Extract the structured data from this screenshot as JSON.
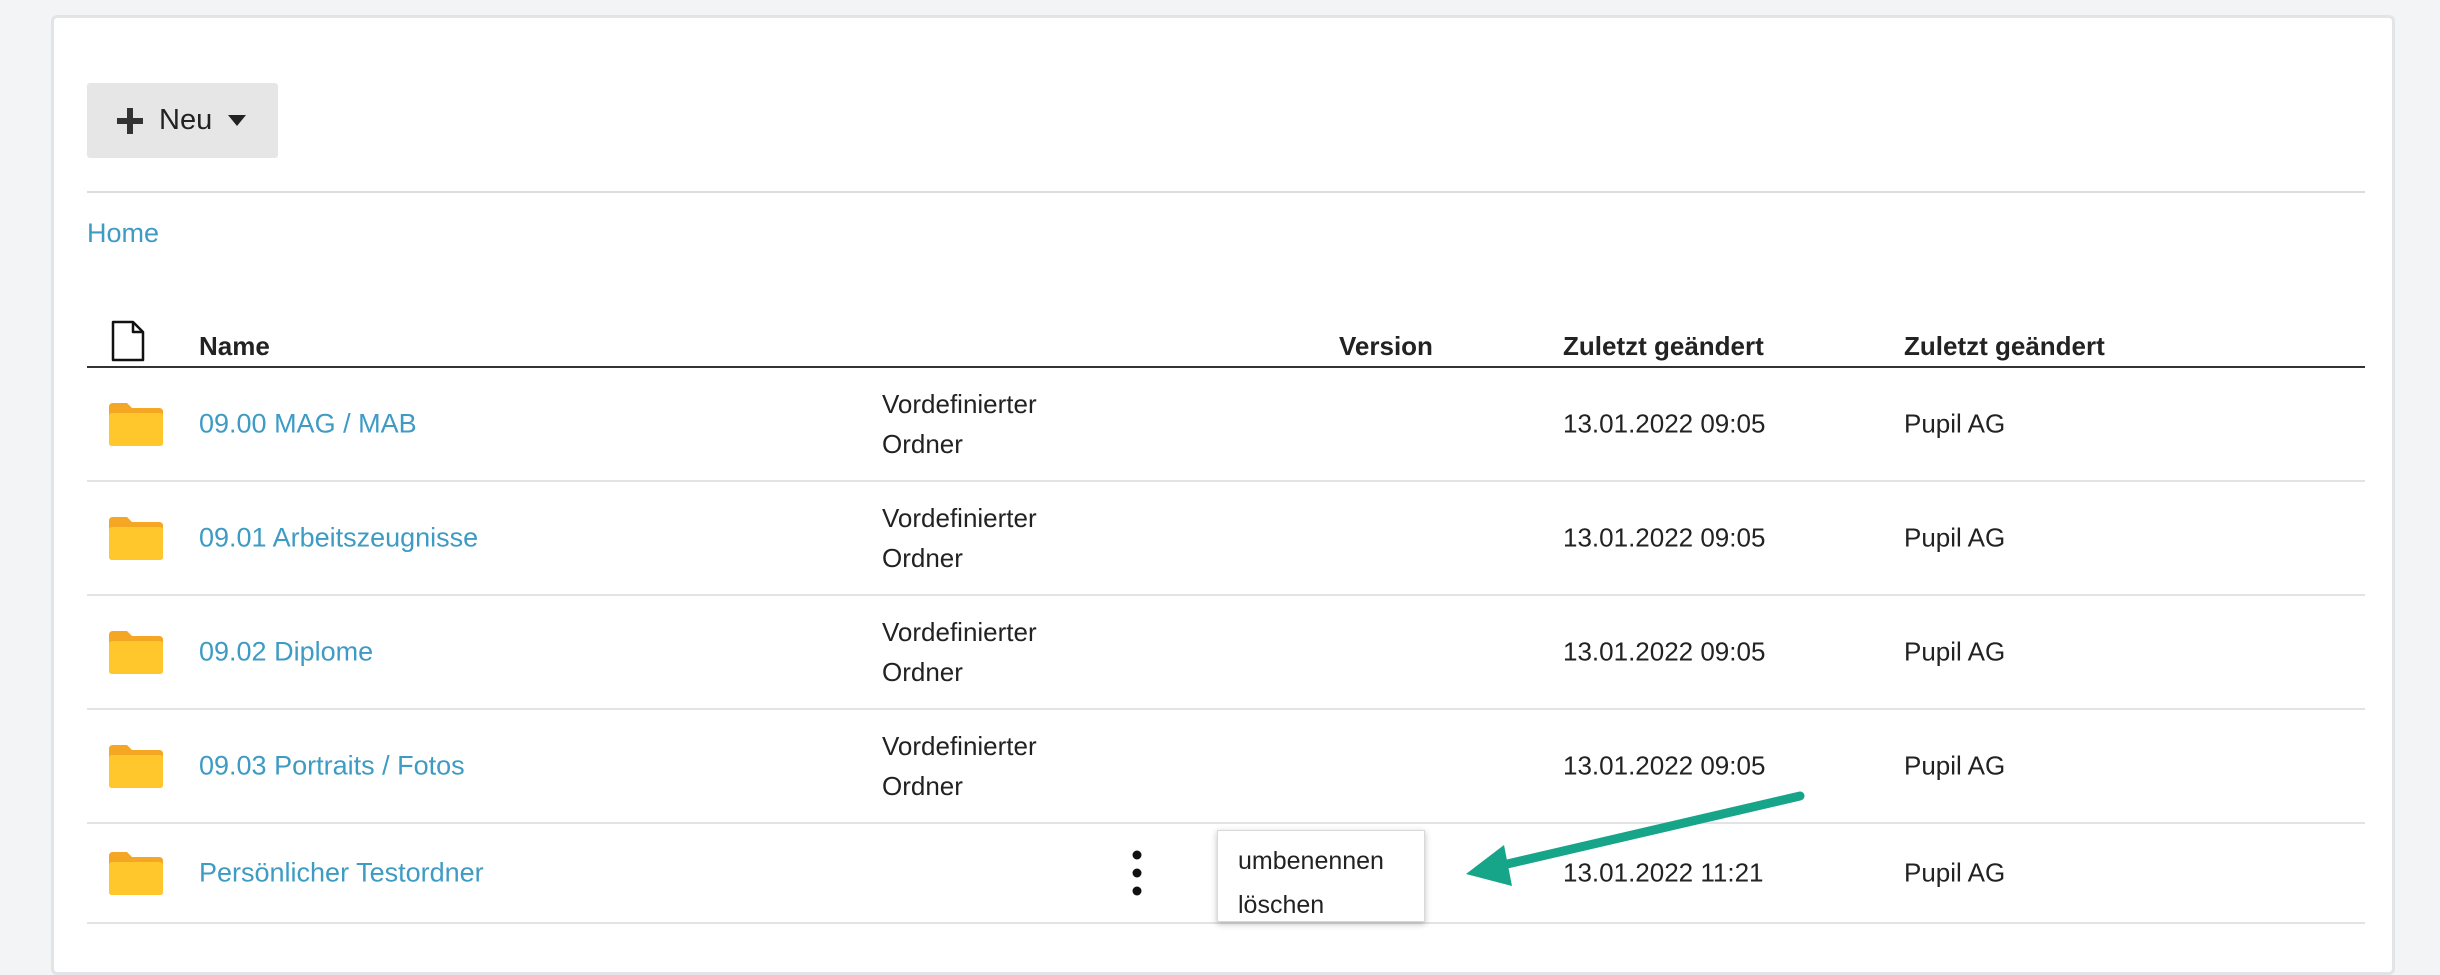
{
  "toolbar": {
    "new_label": "Neu"
  },
  "breadcrumb": {
    "home": "Home"
  },
  "table": {
    "headers": {
      "name": "Name",
      "version": "Version",
      "modified": "Zuletzt geändert",
      "modified_by": "Zuletzt geändert"
    },
    "rows": [
      {
        "name": "09.00 MAG / MAB",
        "type_line1": "Vordefinierter",
        "type_line2": "Ordner",
        "date": "13.01.2022 09:05",
        "owner": "Pupil AG"
      },
      {
        "name": "09.01 Arbeitszeugnisse",
        "type_line1": "Vordefinierter",
        "type_line2": "Ordner",
        "date": "13.01.2022 09:05",
        "owner": "Pupil AG"
      },
      {
        "name": "09.02 Diplome",
        "type_line1": "Vordefinierter",
        "type_line2": "Ordner",
        "date": "13.01.2022 09:05",
        "owner": "Pupil AG"
      },
      {
        "name": "09.03 Portraits / Fotos",
        "type_line1": "Vordefinierter",
        "type_line2": "Ordner",
        "date": "13.01.2022 09:05",
        "owner": "Pupil AG"
      },
      {
        "name": "Persönlicher Testordner",
        "date": "13.01.2022 11:21",
        "owner": "Pupil AG"
      }
    ]
  },
  "context_menu": {
    "rename": "umbenennen",
    "delete": "löschen"
  },
  "colors": {
    "link": "#3d9bc4",
    "folder": "#ffc72c",
    "arrow": "#17a589"
  }
}
